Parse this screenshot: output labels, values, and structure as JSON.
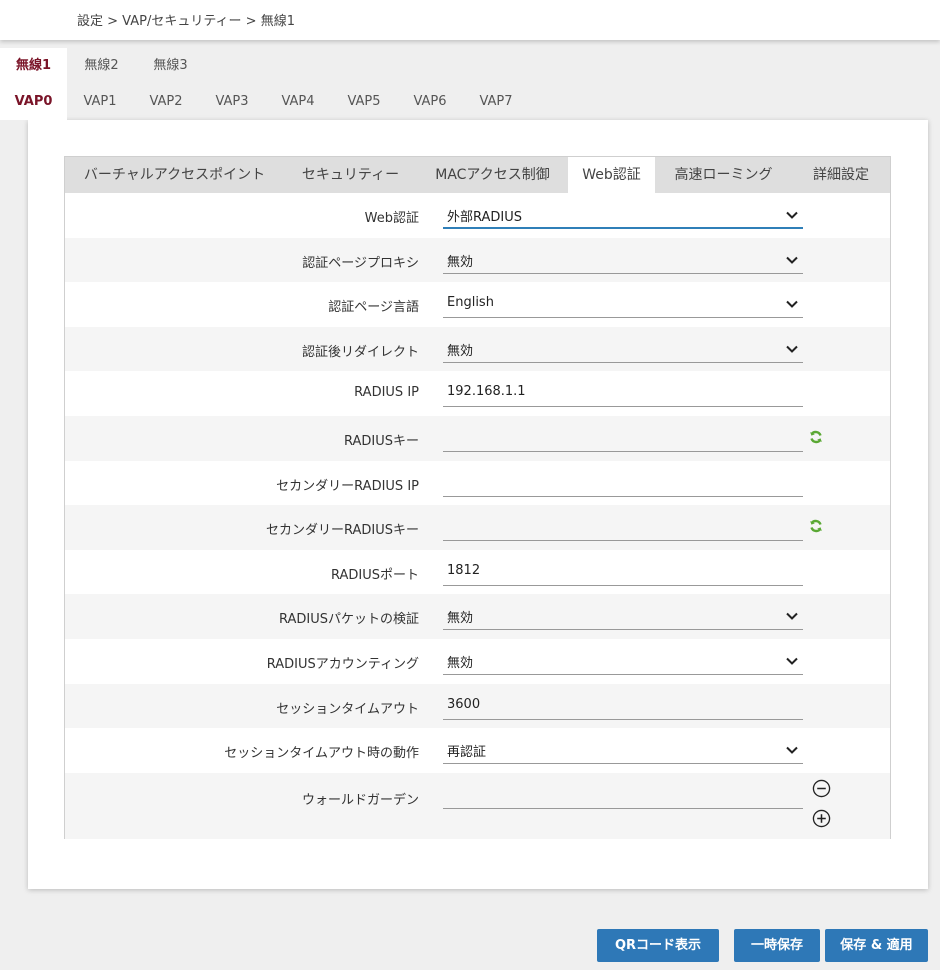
{
  "breadcrumb": "設定 > VAP/セキュリティー > 無線1",
  "wireless_tabs": [
    {
      "label": "無線1",
      "active": true
    },
    {
      "label": "無線2",
      "active": false
    },
    {
      "label": "無線3",
      "active": false
    }
  ],
  "vap_tabs": [
    {
      "label": "VAP0",
      "active": true
    },
    {
      "label": "VAP1",
      "active": false
    },
    {
      "label": "VAP2",
      "active": false
    },
    {
      "label": "VAP3",
      "active": false
    },
    {
      "label": "VAP4",
      "active": false
    },
    {
      "label": "VAP5",
      "active": false
    },
    {
      "label": "VAP6",
      "active": false
    },
    {
      "label": "VAP7",
      "active": false
    }
  ],
  "sub_tabs": [
    {
      "label": "バーチャルアクセスポイント",
      "active": false
    },
    {
      "label": "セキュリティー",
      "active": false
    },
    {
      "label": "MACアクセス制御",
      "active": false
    },
    {
      "label": "Web認証",
      "active": true
    },
    {
      "label": "高速ローミング",
      "active": false
    },
    {
      "label": "詳細設定",
      "active": false
    }
  ],
  "form": {
    "web_auth": {
      "label": "Web認証",
      "value": "外部RADIUS"
    },
    "auth_page_proxy": {
      "label": "認証ページプロキシ",
      "value": "無効"
    },
    "auth_page_lang": {
      "label": "認証ページ言語",
      "value": "English"
    },
    "post_auth_redirect": {
      "label": "認証後リダイレクト",
      "value": "無効"
    },
    "radius_ip": {
      "label": "RADIUS IP",
      "value": "192.168.1.1"
    },
    "radius_key": {
      "label": "RADIUSキー",
      "value": ""
    },
    "secondary_radius_ip": {
      "label": "セカンダリーRADIUS IP",
      "value": ""
    },
    "secondary_radius_key": {
      "label": "セカンダリーRADIUSキー",
      "value": ""
    },
    "radius_port": {
      "label": "RADIUSポート",
      "value": "1812"
    },
    "radius_packet_verify": {
      "label": "RADIUSパケットの検証",
      "value": "無効"
    },
    "radius_accounting": {
      "label": "RADIUSアカウンティング",
      "value": "無効"
    },
    "session_timeout": {
      "label": "セッションタイムアウト",
      "value": "3600"
    },
    "session_timeout_action": {
      "label": "セッションタイムアウト時の動作",
      "value": "再認証"
    },
    "walled_garden": {
      "label": "ウォールドガーデン",
      "value": ""
    }
  },
  "buttons": {
    "qr": "QRコード表示",
    "temp_save": "一時保存",
    "save_apply": "保存 & 適用"
  },
  "colors": {
    "accent": "#2e78b7",
    "active_tab_text": "#7a1428",
    "refresh_icon": "#5aa834"
  }
}
